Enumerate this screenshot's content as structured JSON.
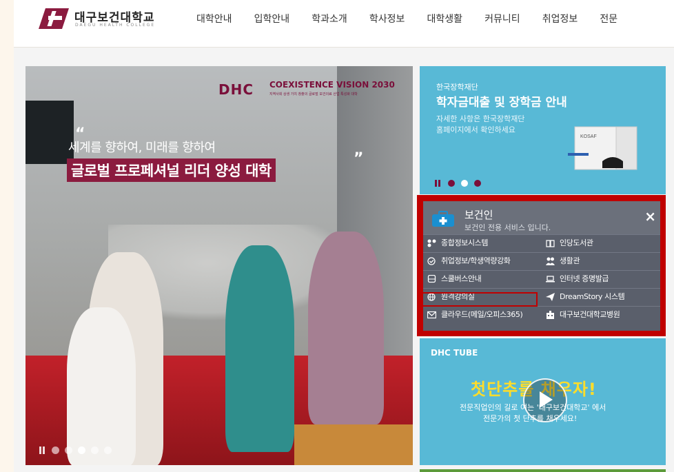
{
  "brand": {
    "name_ko": "대구보건대학교",
    "name_en": "DAEGU HEALTH COLLEGE"
  },
  "nav": [
    "대학안내",
    "입학안내",
    "학과소개",
    "학사정보",
    "대학생활",
    "커뮤니티",
    "취업정보",
    "전문"
  ],
  "hero": {
    "vision_logo": "DHC",
    "vision_title": "COEXISTENCE VISION 2030",
    "vision_sub": "지역사회 상생 가치 창출의 글로벌 보건의료 산업 특성화 대학",
    "quote_open": "“",
    "quote_close": "”",
    "line1": "세계를 향하여, 미래를 향하여",
    "line2": "글로벌 프로페셔널 리더 양성 대학",
    "dots": 5,
    "active_dot": 2
  },
  "banner": {
    "org": "한국장학재단",
    "title": "학자금대출 및 장학금 안내",
    "desc_line1": "자세한 사항은 한국장학재단",
    "desc_line2": "홈페이지에서 확인하세요",
    "book_label": "KOSAF",
    "dots": 3,
    "active_dot": 2
  },
  "panel": {
    "title": "보건인",
    "subtitle": "보건인 전용 서비스 입니다.",
    "close": "×",
    "items": [
      {
        "label": "종합정보시스템",
        "icon": "network-icon"
      },
      {
        "label": "인당도서관",
        "icon": "book-icon"
      },
      {
        "label": "취업정보/학생역량강화",
        "icon": "check-circle-icon"
      },
      {
        "label": "생활관",
        "icon": "people-icon"
      },
      {
        "label": "스쿨버스안내",
        "icon": "bus-icon"
      },
      {
        "label": "인터넷 증명발급",
        "icon": "laptop-icon"
      },
      {
        "label": "원격강의실",
        "icon": "globe-icon"
      },
      {
        "label": "DreamStory 시스템",
        "icon": "paper-plane-icon"
      },
      {
        "label": "클라우드(메일/오피스365)",
        "icon": "mail-icon"
      },
      {
        "label": "대구보건대학교병원",
        "icon": "hospital-icon"
      }
    ],
    "highlight_color": "#c00000"
  },
  "tube": {
    "label": "DHC TUBE",
    "slogan": "첫단추를 채우자!",
    "line1": "전문직업인의 길로 여는 '대구보건대학교' 에서",
    "line2": "전문가의 첫 단추를 채우세요!"
  },
  "colors": {
    "brand": "#7a0f3a",
    "sky": "#58b9d6",
    "panel": "#5a5f6b",
    "highlight": "#c00000"
  }
}
